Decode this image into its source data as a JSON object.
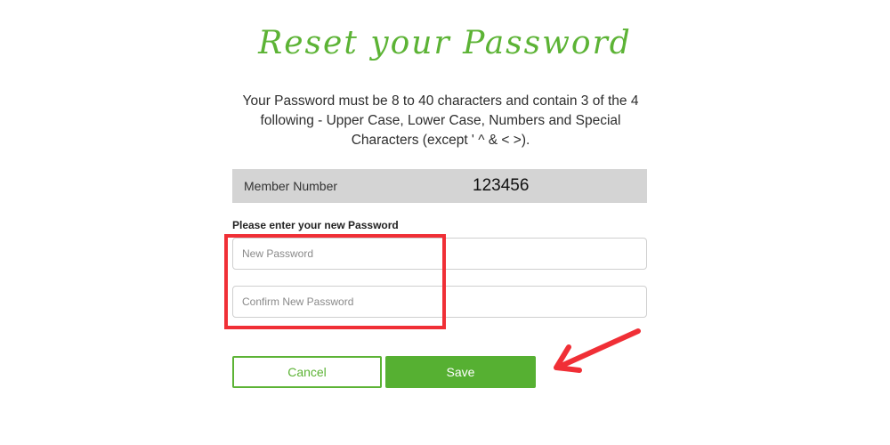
{
  "title": "Reset your Password",
  "instructions": "Your Password must be 8 to 40 characters and contain 3 of the 4 following - Upper Case, Lower Case, Numbers and Special Characters (except ' ^ & < >).",
  "member": {
    "label": "Member Number",
    "value": "123456"
  },
  "password_prompt": "Please enter your new Password",
  "fields": {
    "new_password_placeholder": "New Password",
    "confirm_password_placeholder": "Confirm New Password"
  },
  "buttons": {
    "cancel_label": "Cancel",
    "save_label": "Save"
  },
  "colors": {
    "brand_green": "#5cb335",
    "annotation_red": "#f02f36",
    "member_row_bg": "#d4d4d4"
  }
}
